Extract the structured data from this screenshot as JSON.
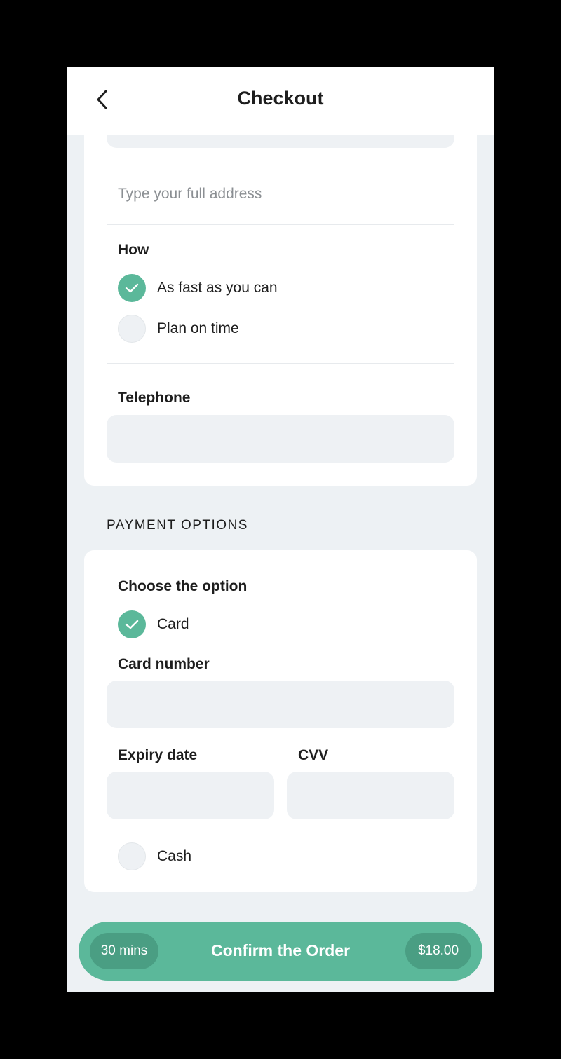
{
  "header": {
    "title": "Checkout",
    "back_icon": "chevron-left-icon"
  },
  "address": {
    "hint": "Type your full address"
  },
  "delivery": {
    "label": "How",
    "options": [
      {
        "label": "As fast as you can",
        "selected": true
      },
      {
        "label": "Plan on time",
        "selected": false
      }
    ]
  },
  "telephone": {
    "label": "Telephone"
  },
  "payment": {
    "section_title": "PAYMENT OPTIONS",
    "choose_label": "Choose the option",
    "options": [
      {
        "label": "Card",
        "selected": true
      },
      {
        "label": "Cash",
        "selected": false
      }
    ],
    "card_number_label": "Card number",
    "expiry_label": "Expiry date",
    "cvv_label": "CVV"
  },
  "footer": {
    "time": "30 mins",
    "confirm_label": "Confirm the Order",
    "price": "$18.00"
  },
  "colors": {
    "accent": "#5bb89a",
    "accent_dark": "#4a9e83",
    "background": "#edf1f4",
    "input_bg": "#eef1f4"
  }
}
